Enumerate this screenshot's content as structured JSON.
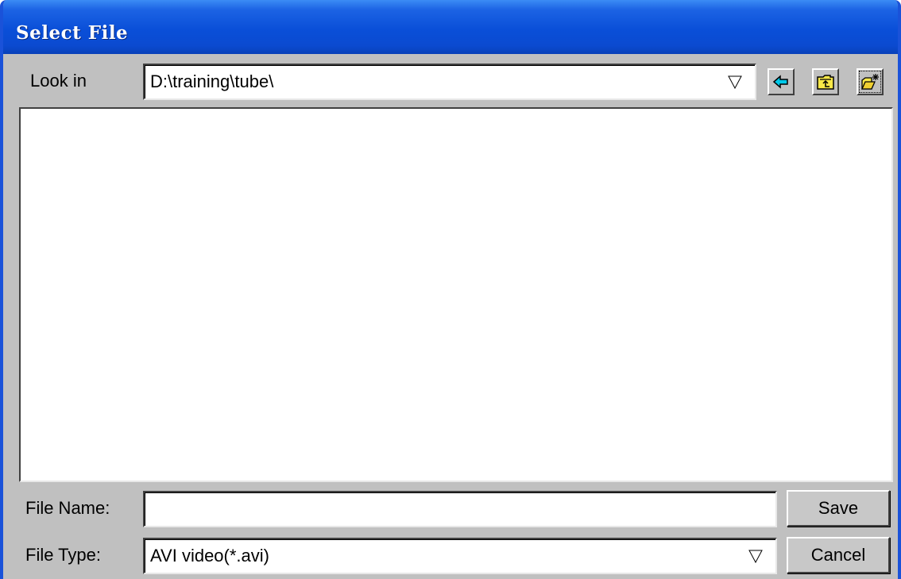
{
  "window": {
    "title": "Select File"
  },
  "look_in": {
    "label": "Look in",
    "value": "D:\\training\\tube\\"
  },
  "toolbar": {
    "icons": [
      "back-arrow-icon",
      "up-folder-icon",
      "new-folder-icon"
    ]
  },
  "file_list": {
    "items": []
  },
  "file_name": {
    "label": "File Name:",
    "value": ""
  },
  "file_type": {
    "label": "File Type:",
    "value": "AVI video(*.avi)"
  },
  "buttons": {
    "save_label": "Save",
    "cancel_label": "Cancel"
  },
  "colors": {
    "titlebar": "#0a4fd8",
    "dialog_bg": "#c0c0c0",
    "back_arrow": "#00c8e8",
    "folder": "#f8e848"
  }
}
